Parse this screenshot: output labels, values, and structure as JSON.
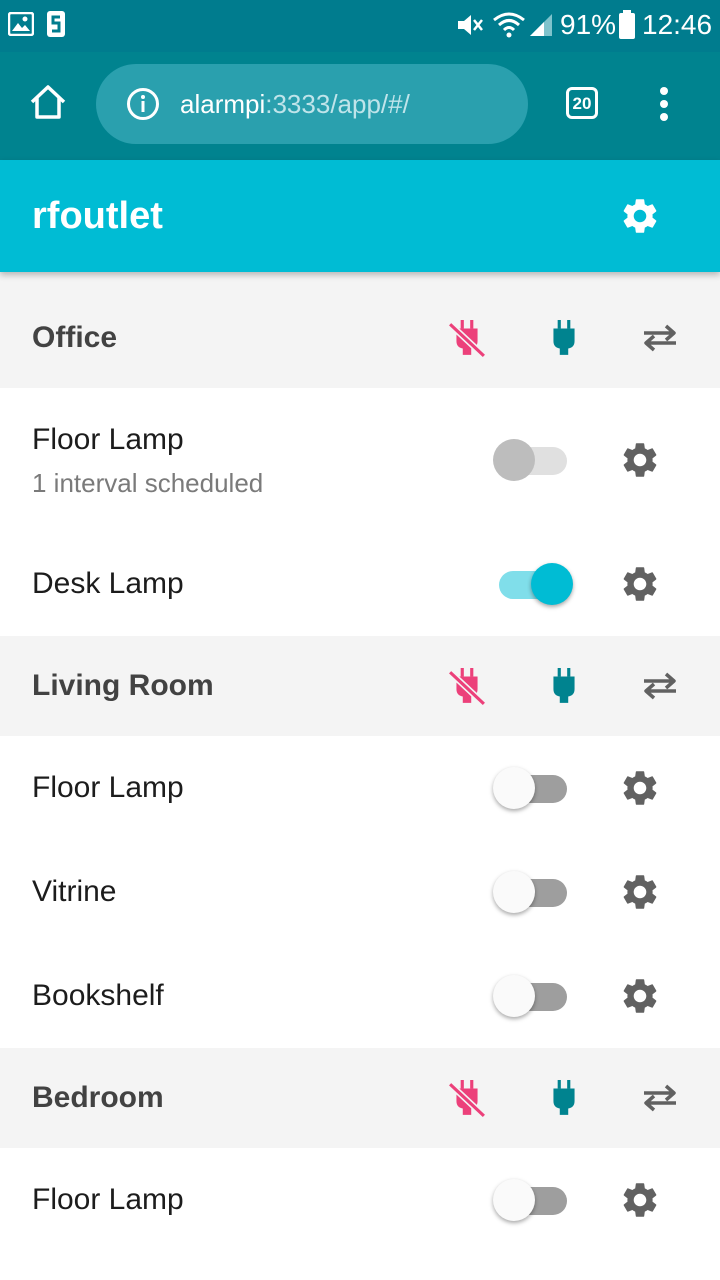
{
  "status_bar": {
    "battery": "91%",
    "time": "12:46"
  },
  "browser": {
    "url_host": "alarmpi",
    "url_rest": ":3333/app/#/",
    "tab_count": "20"
  },
  "app": {
    "title": "rfoutlet"
  },
  "groups": [
    {
      "name": "Office",
      "outlets": [
        {
          "name": "Floor Lamp",
          "subtitle": "1 interval scheduled",
          "state": "disabled"
        },
        {
          "name": "Desk Lamp",
          "state": "on"
        }
      ]
    },
    {
      "name": "Living Room",
      "outlets": [
        {
          "name": "Floor Lamp",
          "state": "off"
        },
        {
          "name": "Vitrine",
          "state": "off"
        },
        {
          "name": "Bookshelf",
          "state": "off"
        }
      ]
    },
    {
      "name": "Bedroom",
      "outlets": [
        {
          "name": "Floor Lamp",
          "state": "off"
        }
      ]
    }
  ],
  "colors": {
    "status_bar": "#007c8e",
    "browser_bar": "#00838f",
    "app_bar": "#00bcd4",
    "power_off_icon": "#ec407a",
    "power_on_icon": "#00838f",
    "toggle_icon": "#616161",
    "gear_icon": "#616161"
  },
  "icons": {
    "group_actions": [
      "power-off-icon",
      "power-on-icon",
      "toggle-icon"
    ],
    "outlet_settings": "gear-icon"
  }
}
